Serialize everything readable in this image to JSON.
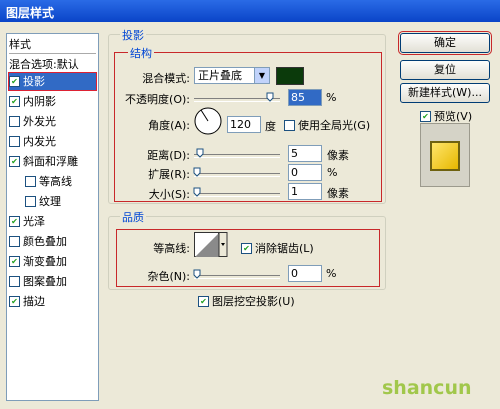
{
  "window": {
    "title": "图层样式"
  },
  "sidebar": {
    "header": "样式",
    "items": [
      {
        "label": "混合选项:默认",
        "check": false,
        "checked": false
      },
      {
        "label": "投影",
        "check": true,
        "checked": true
      },
      {
        "label": "内阴影",
        "check": true,
        "checked": true
      },
      {
        "label": "外发光",
        "check": true,
        "checked": false
      },
      {
        "label": "内发光",
        "check": true,
        "checked": false
      },
      {
        "label": "斜面和浮雕",
        "check": true,
        "checked": true
      },
      {
        "label": "等高线",
        "check": true,
        "checked": false
      },
      {
        "label": "纹理",
        "check": true,
        "checked": false
      },
      {
        "label": "光泽",
        "check": true,
        "checked": true
      },
      {
        "label": "颜色叠加",
        "check": true,
        "checked": false
      },
      {
        "label": "渐变叠加",
        "check": true,
        "checked": true
      },
      {
        "label": "图案叠加",
        "check": true,
        "checked": false
      },
      {
        "label": "描边",
        "check": true,
        "checked": true
      }
    ]
  },
  "shadow": {
    "group_title": "投影",
    "structure_title": "结构",
    "blend_mode_label": "混合模式:",
    "blend_mode_value": "正片叠底",
    "blend_color": "#0b3a0b",
    "opacity_label": "不透明度(O):",
    "opacity_value": "85",
    "percent": "%",
    "angle_label": "角度(A):",
    "angle_value": "120",
    "angle_unit": "度",
    "global_light_label": "使用全局光(G)",
    "distance_label": "距离(D):",
    "distance_value": "5",
    "spread_label": "扩展(R):",
    "spread_value": "0",
    "size_label": "大小(S):",
    "size_value": "1",
    "px_unit": "像素"
  },
  "quality": {
    "group_title": "品质",
    "contour_label": "等高线:",
    "antialias_label": "消除锯齿(L)",
    "noise_label": "杂色(N):",
    "noise_value": "0",
    "percent": "%",
    "knockout_label": "图层挖空投影(U)"
  },
  "buttons": {
    "ok": "确定",
    "reset": "复位",
    "new_style": "新建样式(W)...",
    "preview": "预览(V)"
  },
  "watermark": "shancun"
}
